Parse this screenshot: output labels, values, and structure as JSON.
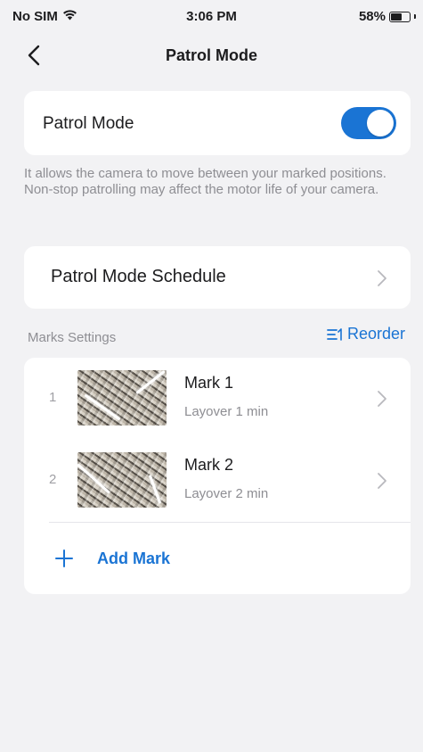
{
  "status_bar": {
    "carrier": "No SIM",
    "time": "3:06 PM",
    "battery": "58%",
    "battery_level": 0.58,
    "wifi_icon": "wifi-icon"
  },
  "nav": {
    "title": "Patrol Mode",
    "back_icon": "chevron-left-icon"
  },
  "patrol": {
    "label": "Patrol Mode",
    "enabled": true,
    "toggle_color": "#1a74d4"
  },
  "description": "It allows the camera to move between your marked positions. Non-stop patrolling may affect the motor life of your camera.",
  "schedule": {
    "label": "Patrol Mode Schedule"
  },
  "marks_section": {
    "label": "Marks Settings",
    "reorder_label": "Reorder",
    "reorder_icon": "reorder-icon"
  },
  "marks": [
    {
      "index": "1",
      "name": "Mark 1",
      "layover": "Layover 1 min"
    },
    {
      "index": "2",
      "name": "Mark 2",
      "layover": "Layover 2 min"
    }
  ],
  "add_mark": {
    "label": "Add Mark",
    "icon": "plus-icon"
  },
  "accent_color": "#1a74d4"
}
